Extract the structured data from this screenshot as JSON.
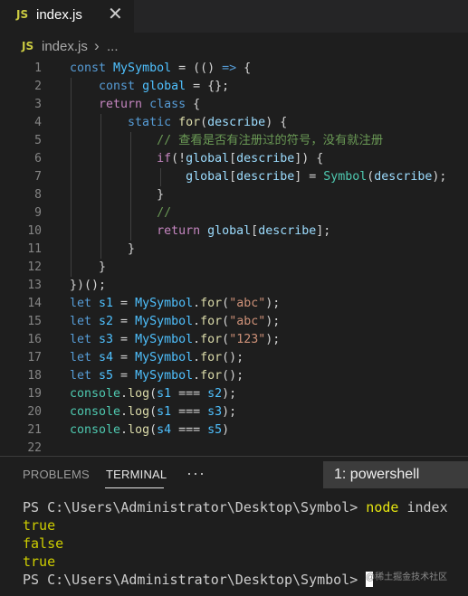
{
  "tab": {
    "badge": "JS",
    "title": "index.js",
    "close": "✕"
  },
  "breadcrumb": {
    "badge": "JS",
    "file": "index.js",
    "separator": "›",
    "more": "..."
  },
  "editor": {
    "line_numbers": [
      "1",
      "2",
      "3",
      "4",
      "5",
      "6",
      "7",
      "8",
      "9",
      "10",
      "11",
      "12",
      "13",
      "14",
      "15",
      "16",
      "17",
      "18",
      "19",
      "20",
      "21",
      "22"
    ],
    "lines": [
      [
        [
          "const ",
          "#569cd6"
        ],
        [
          "MySymbol",
          "#4fc1ff"
        ],
        [
          " = (() ",
          "#d4d4d4"
        ],
        [
          "=>",
          "#569cd6"
        ],
        [
          " {",
          "#d4d4d4"
        ]
      ],
      [
        [
          "    "
        ],
        [
          "const ",
          "#569cd6"
        ],
        [
          "global",
          "#4fc1ff"
        ],
        [
          " = {};",
          "#d4d4d4"
        ]
      ],
      [
        [
          "    "
        ],
        [
          "return ",
          "#c586c0"
        ],
        [
          "class ",
          "#569cd6"
        ],
        [
          "{",
          "#d4d4d4"
        ]
      ],
      [
        [
          "        "
        ],
        [
          "static ",
          "#569cd6"
        ],
        [
          "for",
          "#dcdcaa"
        ],
        [
          "(",
          "#d4d4d4"
        ],
        [
          "describe",
          "#9cdcfe"
        ],
        [
          ") {",
          "#d4d4d4"
        ]
      ],
      [
        [
          "            "
        ],
        [
          "// 查看是否有注册过的符号，没有就注册",
          "#6a9955"
        ]
      ],
      [
        [
          "            "
        ],
        [
          "if",
          "#c586c0"
        ],
        [
          "(!",
          "#d4d4d4"
        ],
        [
          "global",
          "#9cdcfe"
        ],
        [
          "[",
          "#d4d4d4"
        ],
        [
          "describe",
          "#9cdcfe"
        ],
        [
          "]) {",
          "#d4d4d4"
        ]
      ],
      [
        [
          "                "
        ],
        [
          "global",
          "#9cdcfe"
        ],
        [
          "[",
          "#d4d4d4"
        ],
        [
          "describe",
          "#9cdcfe"
        ],
        [
          "] = ",
          "#d4d4d4"
        ],
        [
          "Symbol",
          "#4ec9b0"
        ],
        [
          "(",
          "#d4d4d4"
        ],
        [
          "describe",
          "#9cdcfe"
        ],
        [
          ");",
          "#d4d4d4"
        ]
      ],
      [
        [
          "            "
        ],
        [
          "}",
          "#d4d4d4"
        ]
      ],
      [
        [
          "            "
        ],
        [
          "//",
          "#6a9955"
        ]
      ],
      [
        [
          "            "
        ],
        [
          "return ",
          "#c586c0"
        ],
        [
          "global",
          "#9cdcfe"
        ],
        [
          "[",
          "#d4d4d4"
        ],
        [
          "describe",
          "#9cdcfe"
        ],
        [
          "];",
          "#d4d4d4"
        ]
      ],
      [
        [
          "        "
        ],
        [
          "}",
          "#d4d4d4"
        ]
      ],
      [
        [
          "    "
        ],
        [
          "}",
          "#d4d4d4"
        ]
      ],
      [
        [
          "})();",
          "#d4d4d4"
        ]
      ],
      [
        [
          "let ",
          "#569cd6"
        ],
        [
          "s1",
          "#4fc1ff"
        ],
        [
          " = ",
          "#d4d4d4"
        ],
        [
          "MySymbol",
          "#4fc1ff"
        ],
        [
          ".",
          "#d4d4d4"
        ],
        [
          "for",
          "#dcdcaa"
        ],
        [
          "(",
          "#d4d4d4"
        ],
        [
          "\"abc\"",
          "#ce9178"
        ],
        [
          ");",
          "#d4d4d4"
        ]
      ],
      [
        [
          "let ",
          "#569cd6"
        ],
        [
          "s2",
          "#4fc1ff"
        ],
        [
          " = ",
          "#d4d4d4"
        ],
        [
          "MySymbol",
          "#4fc1ff"
        ],
        [
          ".",
          "#d4d4d4"
        ],
        [
          "for",
          "#dcdcaa"
        ],
        [
          "(",
          "#d4d4d4"
        ],
        [
          "\"abc\"",
          "#ce9178"
        ],
        [
          ");",
          "#d4d4d4"
        ]
      ],
      [
        [
          "let ",
          "#569cd6"
        ],
        [
          "s3",
          "#4fc1ff"
        ],
        [
          " = ",
          "#d4d4d4"
        ],
        [
          "MySymbol",
          "#4fc1ff"
        ],
        [
          ".",
          "#d4d4d4"
        ],
        [
          "for",
          "#dcdcaa"
        ],
        [
          "(",
          "#d4d4d4"
        ],
        [
          "\"123\"",
          "#ce9178"
        ],
        [
          ");",
          "#d4d4d4"
        ]
      ],
      [
        [
          "let ",
          "#569cd6"
        ],
        [
          "s4",
          "#4fc1ff"
        ],
        [
          " = ",
          "#d4d4d4"
        ],
        [
          "MySymbol",
          "#4fc1ff"
        ],
        [
          ".",
          "#d4d4d4"
        ],
        [
          "for",
          "#dcdcaa"
        ],
        [
          "();",
          "#d4d4d4"
        ]
      ],
      [
        [
          "let ",
          "#569cd6"
        ],
        [
          "s5",
          "#4fc1ff"
        ],
        [
          " = ",
          "#d4d4d4"
        ],
        [
          "MySymbol",
          "#4fc1ff"
        ],
        [
          ".",
          "#d4d4d4"
        ],
        [
          "for",
          "#dcdcaa"
        ],
        [
          "();",
          "#d4d4d4"
        ]
      ],
      [
        [
          "console",
          "#4ec9b0"
        ],
        [
          ".",
          "#d4d4d4"
        ],
        [
          "log",
          "#dcdcaa"
        ],
        [
          "(",
          "#d4d4d4"
        ],
        [
          "s1",
          "#4fc1ff"
        ],
        [
          " === ",
          "#d4d4d4"
        ],
        [
          "s2",
          "#4fc1ff"
        ],
        [
          ");",
          "#d4d4d4"
        ]
      ],
      [
        [
          "console",
          "#4ec9b0"
        ],
        [
          ".",
          "#d4d4d4"
        ],
        [
          "log",
          "#dcdcaa"
        ],
        [
          "(",
          "#d4d4d4"
        ],
        [
          "s1",
          "#4fc1ff"
        ],
        [
          " === ",
          "#d4d4d4"
        ],
        [
          "s3",
          "#4fc1ff"
        ],
        [
          ");",
          "#d4d4d4"
        ]
      ],
      [
        [
          "console",
          "#4ec9b0"
        ],
        [
          ".",
          "#d4d4d4"
        ],
        [
          "log",
          "#dcdcaa"
        ],
        [
          "(",
          "#d4d4d4"
        ],
        [
          "s4",
          "#4fc1ff"
        ],
        [
          " === ",
          "#d4d4d4"
        ],
        [
          "s5",
          "#4fc1ff"
        ],
        [
          ")",
          "#d4d4d4"
        ]
      ],
      []
    ]
  },
  "panel": {
    "tabs": [
      "PROBLEMS",
      "TERMINAL"
    ],
    "active_tab": "TERMINAL",
    "more": "···",
    "shell_select": "1: powershell"
  },
  "terminal": {
    "prompt": "PS C:\\Users\\Administrator\\Desktop\\Symbol> ",
    "command": "node",
    "command_arg": " index",
    "output": [
      "true",
      "false",
      "true"
    ],
    "output_color": "#cdcd00",
    "command_color": "#e5e510"
  },
  "watermark": "@稀土掘金技术社区"
}
